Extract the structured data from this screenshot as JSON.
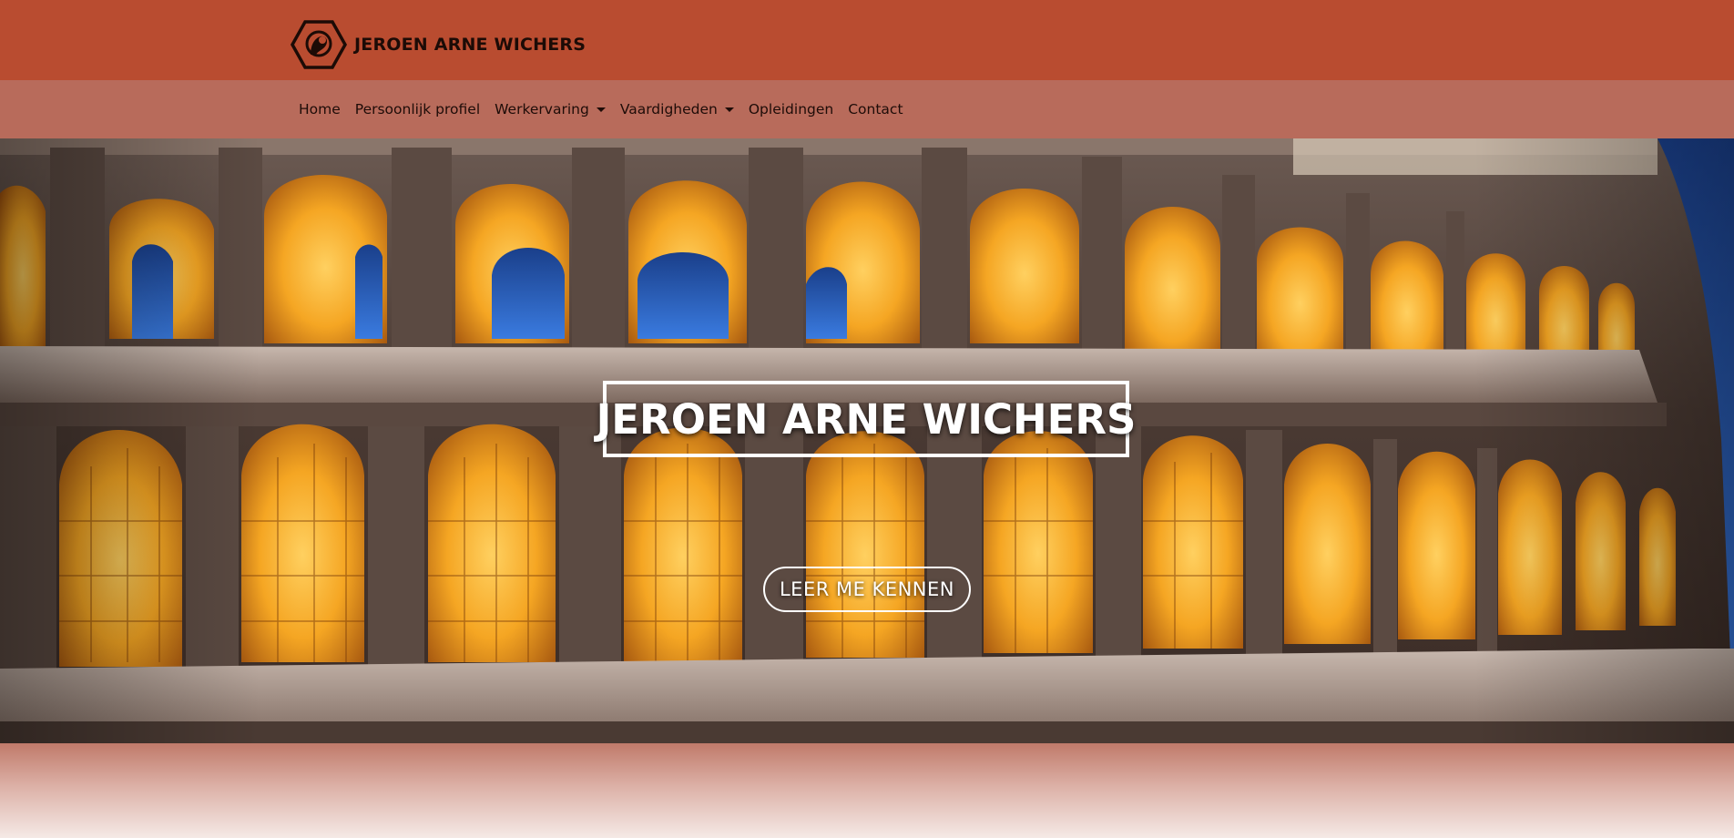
{
  "header": {
    "brand_name": "JEROEN ARNE WICHERS",
    "logo_icon": "hexagon-profile-icon"
  },
  "nav": {
    "items": [
      {
        "label": "Home",
        "dropdown": false
      },
      {
        "label": "Persoonlijk profiel",
        "dropdown": false
      },
      {
        "label": "Werkervaring",
        "dropdown": true
      },
      {
        "label": "Vaardigheden",
        "dropdown": true
      },
      {
        "label": "Opleidingen",
        "dropdown": false
      },
      {
        "label": "Contact",
        "dropdown": false
      }
    ]
  },
  "hero": {
    "title": "JEROEN ARNE WICHERS",
    "button_label": "LEER ME KENNEN"
  },
  "colors": {
    "topbar": "#b94c30",
    "navbar": "#b86b5b",
    "text_dark": "#1c0b06",
    "hero_text": "#ffffff",
    "arch_glow": "#f5a623"
  }
}
